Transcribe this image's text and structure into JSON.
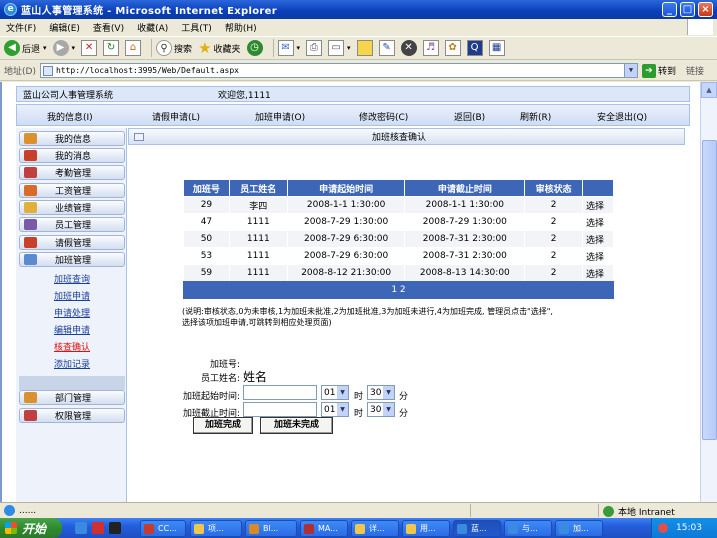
{
  "window": {
    "title": "蓝山人事管理系统 - Microsoft Internet Explorer",
    "minimize": "_",
    "maximize": "□",
    "close": "×"
  },
  "menu": [
    "文件(F)",
    "编辑(E)",
    "查看(V)",
    "收藏(A)",
    "工具(T)",
    "帮助(H)"
  ],
  "toolbar": {
    "back_label": "后退",
    "search_label": "搜索",
    "favorites_label": "收藏夹"
  },
  "address": {
    "label": "地址(D)",
    "url": "http://localhost:3995/Web/Default.aspx",
    "go_label": "转到",
    "links_label": "链接"
  },
  "system_bar": {
    "system_name": "蓝山公司人事管理系统",
    "welcome": "欢迎您,1111"
  },
  "nav": {
    "items": [
      "我的信息(I)",
      "请假申请(L)",
      "加班申请(O)",
      "修改密码(C)",
      "返回(B)",
      "刷新(R)",
      "安全退出(Q)"
    ]
  },
  "sidebar": {
    "groups": [
      "我的信息",
      "我的消息",
      "考勤管理",
      "工资管理",
      "业绩管理",
      "员工管理",
      "请假管理",
      "加班管理"
    ],
    "sub_items": [
      "加班查询",
      "加班申请",
      "申请处理",
      "编辑申请",
      "核查确认",
      "添加记录"
    ],
    "active_sub": "核查确认",
    "bottom_groups": [
      "部门管理",
      "权限管理"
    ],
    "icon_colors": [
      "#D9922E",
      "#C8402A",
      "#C04040",
      "#D86A2A",
      "#E0B03A",
      "#7A5AA8",
      "#C8402A",
      "#5A8AD0",
      "#D9922E",
      "#C04040"
    ]
  },
  "main": {
    "header_title": "加班核查确认",
    "table": {
      "headers": [
        "加班号",
        "员工姓名",
        "申请起始时间",
        "申请截止时间",
        "审核状态",
        ""
      ],
      "rows": [
        {
          "id": "29",
          "name": "李四",
          "start": "2008-1-1 1:30:00",
          "end": "2008-1-1 1:30:00",
          "status": "2",
          "action": "选择"
        },
        {
          "id": "47",
          "name": "1111",
          "start": "2008-7-29 1:30:00",
          "end": "2008-7-29 1:30:00",
          "status": "2",
          "action": "选择"
        },
        {
          "id": "50",
          "name": "1111",
          "start": "2008-7-29 6:30:00",
          "end": "2008-7-31 2:30:00",
          "status": "2",
          "action": "选择"
        },
        {
          "id": "53",
          "name": "1111",
          "start": "2008-7-29 6:30:00",
          "end": "2008-7-31 2:30:00",
          "status": "2",
          "action": "选择"
        },
        {
          "id": "59",
          "name": "1111",
          "start": "2008-8-12 21:30:00",
          "end": "2008-8-13 14:30:00",
          "status": "2",
          "action": "选择"
        }
      ],
      "pager": "1 2"
    },
    "note_line1": "(说明:审核状态,0为未审核,1为加班未批准,2为加班批准,3为加班未进行,4为加班完成, 管理员点击\"选择\",",
    "note_line2": "选择该项加班申请,可跳转到相应处理页面)",
    "form": {
      "id_label": "加班号:",
      "name_label": "员工姓名:",
      "name_value": "姓名",
      "start_label": "加班起始时间:",
      "end_label": "加班截止时间:",
      "start_hour": "01",
      "start_minute": "30",
      "end_hour": "01",
      "end_minute": "30",
      "hour_unit": "时",
      "minute_unit": "分",
      "complete_button": "加班完成",
      "incomplete_button": "加班未完成"
    }
  },
  "status": {
    "text": "......",
    "zone": "本地 Intranet"
  },
  "taskbar": {
    "start_label": "开始",
    "tasks": [
      "CC...",
      "项...",
      "Bl...",
      "MA...",
      "详...",
      "用...",
      "蓝...",
      "与...",
      "加..."
    ],
    "active_task_index": 6,
    "clock": "15:03"
  }
}
